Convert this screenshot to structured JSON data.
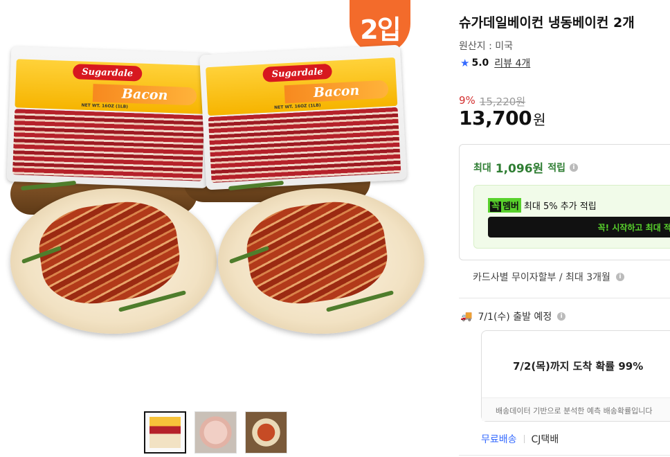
{
  "media": {
    "badge": "2입",
    "pack_brand": "Sugardale",
    "pack_product": "Bacon",
    "pack_weight": "NET WT. 16OZ (1LB)",
    "thumbnails": [
      "bacon-2pack-thumb",
      "raw-bacon-thumb",
      "cooked-bacon-thumb"
    ]
  },
  "product": {
    "title": "슈가데일베이컨 냉동베이컨 2개",
    "origin": "원산지 : 미국",
    "rating": "5.0",
    "reviews": "리뷰 4개",
    "discount_pct": "9%",
    "original_price": "15,220원",
    "price": "13,700",
    "price_unit": "원"
  },
  "reward": {
    "prefix": "최대",
    "amount": "1,096원",
    "suffix": "적립",
    "member_tag_k": "꼭",
    "member_tag_label": "멤버",
    "member_text": "최대 5% 추가 적립",
    "member_button": "꼭! 시작하고 최대 적립"
  },
  "installment": "카드사별 무이자할부 / 최대 3개월",
  "shipping": {
    "dispatch": "7/1(수) 출발 예정",
    "arrival": "7/2(목)까지 도착 확률 99%",
    "note": "배송데이터 기반으로 분석한 예측 배송확률입니다",
    "method": "무료배송",
    "carrier": "CJ택배"
  },
  "colors": {
    "accent_blue": "#346aff",
    "discount_red": "#d32f2f",
    "reward_green": "#2e7d32",
    "member_green": "#58d12c",
    "badge_orange": "#f36b2b"
  }
}
